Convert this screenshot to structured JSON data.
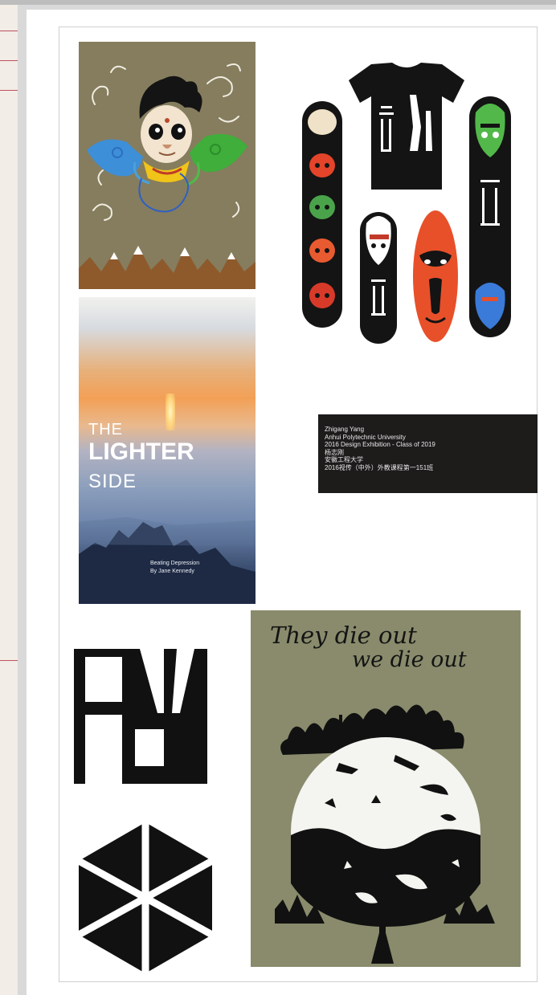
{
  "poster": {
    "title_line_1": "THE",
    "title_line_2": "LIGHTER",
    "title_line_3": "SIDE",
    "subtitle_line_1": "Beating Depression",
    "subtitle_line_2": "By Jane Kennedy"
  },
  "caption": {
    "line_1": "Zhigang Yang",
    "line_2": "Anhui Polytechnic University",
    "line_3": "2016 Design Exhibition - Class of  2019",
    "line_4": "杨志刚",
    "line_5": "安徽工程大学",
    "line_6": "2016视传（中外）外教课程第一151班"
  },
  "tshirt": {
    "slogan_line_1": "They die out",
    "slogan_line_2": "we die out"
  },
  "colors": {
    "olive": "#857d5e",
    "black": "#111111",
    "opera_red": "#e8502a"
  }
}
